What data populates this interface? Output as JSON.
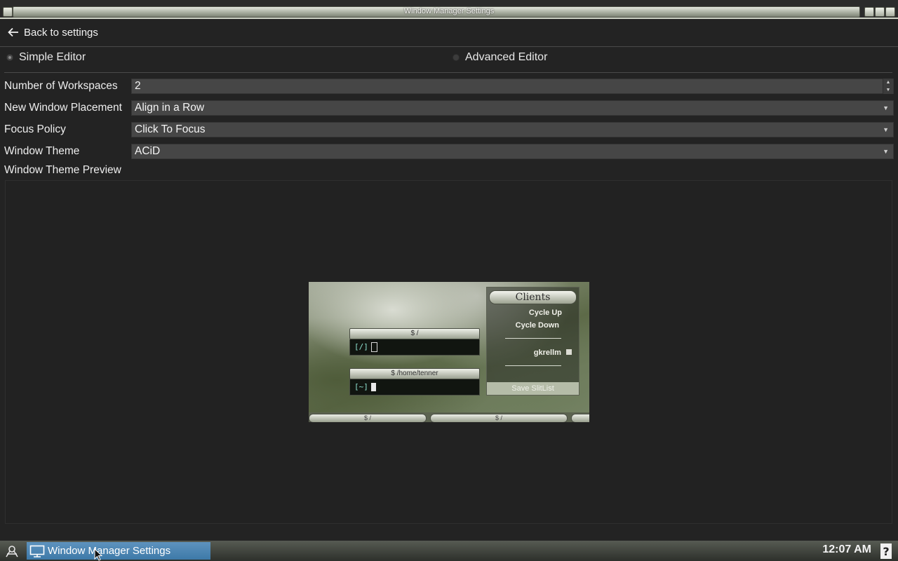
{
  "window": {
    "title": "Window Manager Settings"
  },
  "nav": {
    "back_label": "Back to settings"
  },
  "editor_mode": {
    "options": [
      {
        "label": "Simple Editor",
        "selected": true
      },
      {
        "label": "Advanced Editor",
        "selected": false
      }
    ]
  },
  "settings": {
    "workspaces": {
      "label": "Number of Workspaces",
      "value": "2"
    },
    "placement": {
      "label": "New Window Placement",
      "value": "Align in a Row"
    },
    "focus": {
      "label": "Focus Policy",
      "value": "Click To Focus"
    },
    "theme": {
      "label": "Window Theme",
      "value": "ACiD"
    }
  },
  "preview": {
    "label": "Window Theme Preview",
    "term1_title": "$ /",
    "term1_prompt": "[/]",
    "term2_title": "$  /home/tenner",
    "term2_prompt": "[~]",
    "menu_title": "Clients",
    "menu_items": [
      "Cycle Up",
      "Cycle Down"
    ],
    "slit_item": "gkrellm",
    "menu_footer": "Save SlitList",
    "dock_items": [
      "$ /",
      "$ /"
    ]
  },
  "taskbar": {
    "task_label": "Window Manager Settings",
    "clock": "12:07 AM"
  },
  "colors": {
    "task_active": "#4a86b4",
    "background": "#232323",
    "field": "#464646"
  }
}
